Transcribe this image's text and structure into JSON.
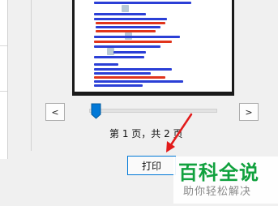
{
  "navigation": {
    "prev_label": "<",
    "next_label": ">"
  },
  "page_indicator": {
    "text": "第 1 页，共 2 页",
    "current_page": 1,
    "total_pages": 2
  },
  "slider": {
    "position_fraction": 0.05
  },
  "print_button": {
    "label": "打印"
  },
  "watermark": {
    "title": "百科全说",
    "subtitle": "助你轻松解决"
  },
  "colors": {
    "accent_blue": "#0078d7",
    "annotation_arrow": "#e21a1a",
    "watermark_green": "#11a13e",
    "paper_text_blue": "#2b3fd6",
    "paper_text_red": "#e0341c"
  },
  "icons": {
    "annotation": "red-arrow-icon"
  }
}
